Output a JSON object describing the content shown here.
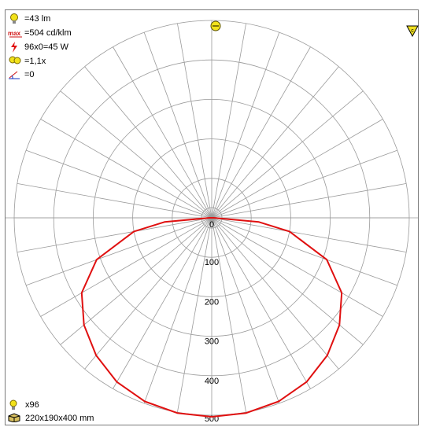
{
  "info": {
    "flux": "=43 lm",
    "max_intensity": "=504 cd/klm",
    "power": "96x0=45 W",
    "factor": "=1,1x",
    "tilt": "=0"
  },
  "footer": {
    "count": "x96",
    "dimensions": "220x190x400 mm"
  },
  "colors": {
    "curve": "#e01010",
    "grid": "#9a9a9a",
    "frame": "#7a7a7a"
  },
  "icons": {
    "flux": "bulb-icon",
    "max": "max-icon",
    "power": "lightning-icon",
    "factor": "bulbs-icon",
    "tilt": "tilt-icon",
    "top": "lamp-icon",
    "corner": "warning-triangle-icon",
    "count": "bulb-icon",
    "dimensions": "box-icon"
  },
  "chart_data": {
    "type": "polar",
    "radial_unit": "cd/klm",
    "radial_ticks": [
      "0",
      "100",
      "200",
      "300",
      "400",
      "500"
    ],
    "radial_range": [
      0,
      500
    ],
    "angle_step_deg": 10,
    "angle_convention": "0 = straight down, 90 = horizontal, 180 = straight up",
    "series": [
      {
        "color": "#e01010",
        "angles": [
          0,
          10,
          20,
          30,
          40,
          50,
          60,
          70,
          80,
          85,
          90
        ],
        "values": [
          504,
          502,
          495,
          480,
          455,
          422,
          380,
          310,
          200,
          120,
          5
        ]
      }
    ]
  }
}
